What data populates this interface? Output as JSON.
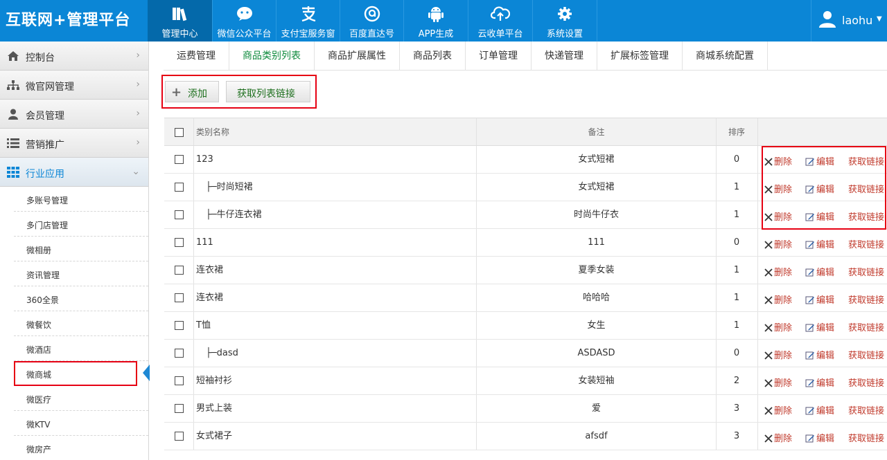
{
  "logo": "互联网+管理平台",
  "nav": [
    {
      "label": "管理中心",
      "icon": "books-icon"
    },
    {
      "label": "微信公众平台",
      "icon": "wechat-icon"
    },
    {
      "label": "支付宝服务窗",
      "icon": "alipay-icon"
    },
    {
      "label": "百度直达号",
      "icon": "baidu-icon"
    },
    {
      "label": "APP生成",
      "icon": "android-icon"
    },
    {
      "label": "云收单平台",
      "icon": "cloud-upload-icon"
    },
    {
      "label": "系统设置",
      "icon": "gear-icon"
    }
  ],
  "user": {
    "name": "laohu"
  },
  "sidebar": {
    "menus": [
      {
        "label": "控制台",
        "icon": "home-icon"
      },
      {
        "label": "微官网管理",
        "icon": "sitemap-icon"
      },
      {
        "label": "会员管理",
        "icon": "user-icon"
      },
      {
        "label": "营销推广",
        "icon": "list-icon"
      },
      {
        "label": "行业应用",
        "icon": "grid-icon"
      }
    ],
    "subitems": [
      "多账号管理",
      "多门店管理",
      "微相册",
      "资讯管理",
      "360全景",
      "微餐饮",
      "微酒店",
      "微商城",
      "微医疗",
      "微KTV",
      "微房产"
    ]
  },
  "tabs": [
    "运费管理",
    "商品类别列表",
    "商品扩展属性",
    "商品列表",
    "订单管理",
    "快递管理",
    "扩展标签管理",
    "商城系统配置"
  ],
  "buttons": {
    "add": "添加",
    "get_link": "获取列表链接"
  },
  "table": {
    "headers": {
      "name": "类别名称",
      "note": "备注",
      "sort": "排序"
    },
    "actions": {
      "delete": "删除",
      "edit": "编辑",
      "get": "获取链接"
    },
    "rows": [
      {
        "name": "123",
        "note": "女式短裙",
        "sort": "0"
      },
      {
        "name": "├─时尚短裙",
        "note": "女式短裙",
        "sort": "1"
      },
      {
        "name": "├─牛仔连衣裙",
        "note": "时尚牛仔衣",
        "sort": "1"
      },
      {
        "name": "111",
        "note": "111",
        "sort": "0"
      },
      {
        "name": "连衣裙",
        "note": "夏季女装",
        "sort": "1"
      },
      {
        "name": "连衣裙",
        "note": "哈哈哈",
        "sort": "1"
      },
      {
        "name": "T恤",
        "note": "女生",
        "sort": "1"
      },
      {
        "name": "├─dasd",
        "note": "ASDASD",
        "sort": "0"
      },
      {
        "name": "短袖衬衫",
        "note": "女装短袖",
        "sort": "2"
      },
      {
        "name": "男式上装",
        "note": "爱",
        "sort": "3"
      },
      {
        "name": "女式裙子",
        "note": "afsdf",
        "sort": "3"
      }
    ]
  }
}
